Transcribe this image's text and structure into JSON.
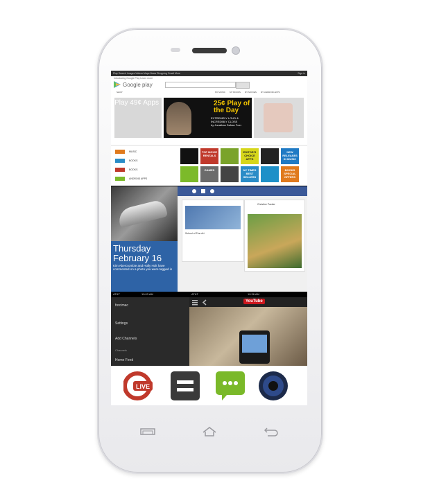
{
  "google_play": {
    "topbar": "Play  Search  Images  Videos  Maps  News  Shopping  Gmail  More",
    "signin": "Sign in",
    "intro": "Introducing Google Play  Learn more",
    "logo": "Google play",
    "shop": "SHOP",
    "tabs": [
      "MY MUSIC",
      "MY BOOKS",
      "MY MOVIES",
      "MY ANDROID APPS"
    ],
    "promo_left": "Play 49¢ Apps",
    "promo_title": "25¢ Play of the Day",
    "promo_desc": "EXTREMELY LOUD & INCREDIBLY CLOSE",
    "promo_author": "by Jonathan Safran Foer"
  },
  "categories": [
    "MUSIC",
    "BOOKS",
    "BOOKS",
    "ANDROID APPS"
  ],
  "tiles": [
    {
      "label": "TOP MOVIE RENTALS",
      "color": "#c0392b"
    },
    {
      "label": "EDITOR'S CHOICE APPS",
      "color": "#d6d61a"
    },
    {
      "label": "NEW RELEASES IN MUSIC",
      "color": "#1f7ac4"
    },
    {
      "label": "GAMES",
      "color": "#6b6b6b"
    },
    {
      "label": "NY TIMES BEST SELLERS",
      "color": "#2a8cc7"
    },
    {
      "label": "BOOKS SPECIAL OFFERS",
      "color": "#e07a1d"
    }
  ],
  "calendar": {
    "day": "Thursday",
    "date": "February 16",
    "note": "Kim Abercrombie and Holly Holt have commented on a photo you were tagged in"
  },
  "facebook": {
    "post1": "School of Fine Art",
    "post2": "Christine Packer"
  },
  "social": {
    "status_left": "AT&T",
    "time_left": "10:03 AM",
    "time_right": "10:36 AM",
    "user": "forcimac",
    "settings": "Settings",
    "add": "Add Channels",
    "channels": "Channels",
    "feed": "Home Feed"
  },
  "youtube": {
    "logo": "YouTube"
  },
  "dock_icons": [
    "live-tv-icon",
    "menu-icon",
    "messaging-icon",
    "music-speaker-icon"
  ]
}
